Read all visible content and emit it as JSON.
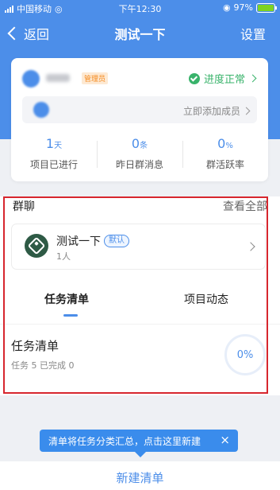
{
  "status_bar": {
    "carrier": "中国移动",
    "time": "下午12:30",
    "battery": "97%"
  },
  "nav": {
    "back_label": "返回",
    "title": "测试一下",
    "settings_label": "设置"
  },
  "project": {
    "role_badge": "管理员",
    "progress_status": "进度正常",
    "add_member": "立即添加成员",
    "stats": [
      {
        "value": "1",
        "unit": "天",
        "label": "项目已进行"
      },
      {
        "value": "0",
        "unit": "条",
        "label": "昨日群消息"
      },
      {
        "value": "0",
        "unit": "%",
        "label": "群活跃率"
      }
    ]
  },
  "group": {
    "title": "群聊",
    "view_all": "查看全部",
    "name": "测试一下",
    "default_badge": "默认",
    "member_count": "1人"
  },
  "tabs": {
    "active": "任务清单",
    "inactive": "项目动态"
  },
  "task_list": {
    "title": "任务清单",
    "subtitle": "任务 5  已完成 0",
    "percent": "0%"
  },
  "tooltip": {
    "text": "清单将任务分类汇总，点击这里新建",
    "close": "×"
  },
  "bottom": {
    "new_list": "新建清单"
  },
  "colors": {
    "brand": "#4c8ee9",
    "success": "#39b36b",
    "highlight_box": "#d7262e"
  }
}
